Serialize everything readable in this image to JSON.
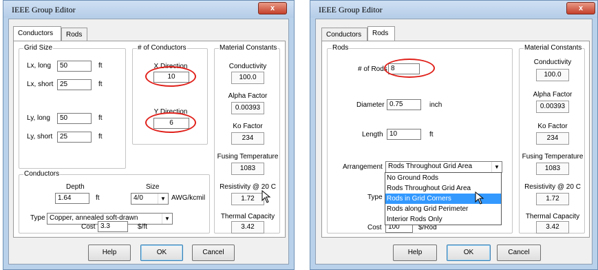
{
  "left": {
    "title": "IEEE Group Editor",
    "close": "x",
    "tabs": [
      "Conductors",
      "Rods"
    ],
    "grid_size": {
      "label": "Grid Size",
      "lx_long": {
        "label": "Lx, long",
        "value": "50",
        "unit": "ft"
      },
      "lx_short": {
        "label": "Lx, short",
        "value": "25",
        "unit": "ft"
      },
      "ly_long": {
        "label": "Ly, long",
        "value": "50",
        "unit": "ft"
      },
      "ly_short": {
        "label": "Ly, short",
        "value": "25",
        "unit": "ft"
      }
    },
    "num_conductors": {
      "label": "# of Conductors",
      "x_label": "X Direction",
      "x_value": "10",
      "y_label": "Y Direction",
      "y_value": "6"
    },
    "conductors": {
      "label": "Conductors",
      "depth_label": "Depth",
      "depth_value": "1.64",
      "depth_unit": "ft",
      "size_label": "Size",
      "size_value": "4/0",
      "size_unit": "AWG/kcmil",
      "type_label": "Type",
      "type_value": "Copper, annealed soft-drawn",
      "cost_label": "Cost",
      "cost_value": "3.3",
      "cost_unit": "$/ft"
    },
    "material": {
      "label": "Material Constants",
      "conductivity_label": "Conductivity",
      "conductivity_value": "100.0",
      "alpha_label": "Alpha Factor",
      "alpha_value": "0.00393",
      "ko_label": "Ko Factor",
      "ko_value": "234",
      "fusing_label": "Fusing Temperature",
      "fusing_value": "1083",
      "resistivity_label": "Resistivity @ 20 C",
      "resistivity_value": "1.72",
      "thermal_label": "Thermal Capacity",
      "thermal_value": "3.42"
    },
    "buttons": {
      "help": "Help",
      "ok": "OK",
      "cancel": "Cancel"
    }
  },
  "right": {
    "title": "IEEE Group Editor",
    "close": "x",
    "tabs": [
      "Conductors",
      "Rods"
    ],
    "rods": {
      "label": "Rods",
      "num_label": "# of Rods",
      "num_value": "8",
      "diameter_label": "Diameter",
      "diameter_value": "0.75",
      "diameter_unit": "inch",
      "length_label": "Length",
      "length_value": "10",
      "length_unit": "ft",
      "arrangement_label": "Arrangement",
      "arrangement_value": "Rods Throughout Grid Area",
      "arrangement_options": [
        "No Ground Rods",
        "Rods Throughout Grid Area",
        "Rods in Grid Corners",
        "Rods along Grid Perimeter",
        "Interior Rods Only"
      ],
      "type_label": "Type",
      "cost_label": "Cost",
      "cost_value": "100",
      "cost_unit": "$/Rod"
    },
    "material": {
      "label": "Material Constants",
      "conductivity_label": "Conductivity",
      "conductivity_value": "100.0",
      "alpha_label": "Alpha Factor",
      "alpha_value": "0.00393",
      "ko_label": "Ko Factor",
      "ko_value": "234",
      "fusing_label": "Fusing Temperature",
      "fusing_value": "1083",
      "resistivity_label": "Resistivity @ 20 C",
      "resistivity_value": "1.72",
      "thermal_label": "Thermal Capacity",
      "thermal_value": "3.42"
    },
    "buttons": {
      "help": "Help",
      "ok": "OK",
      "cancel": "Cancel"
    }
  }
}
